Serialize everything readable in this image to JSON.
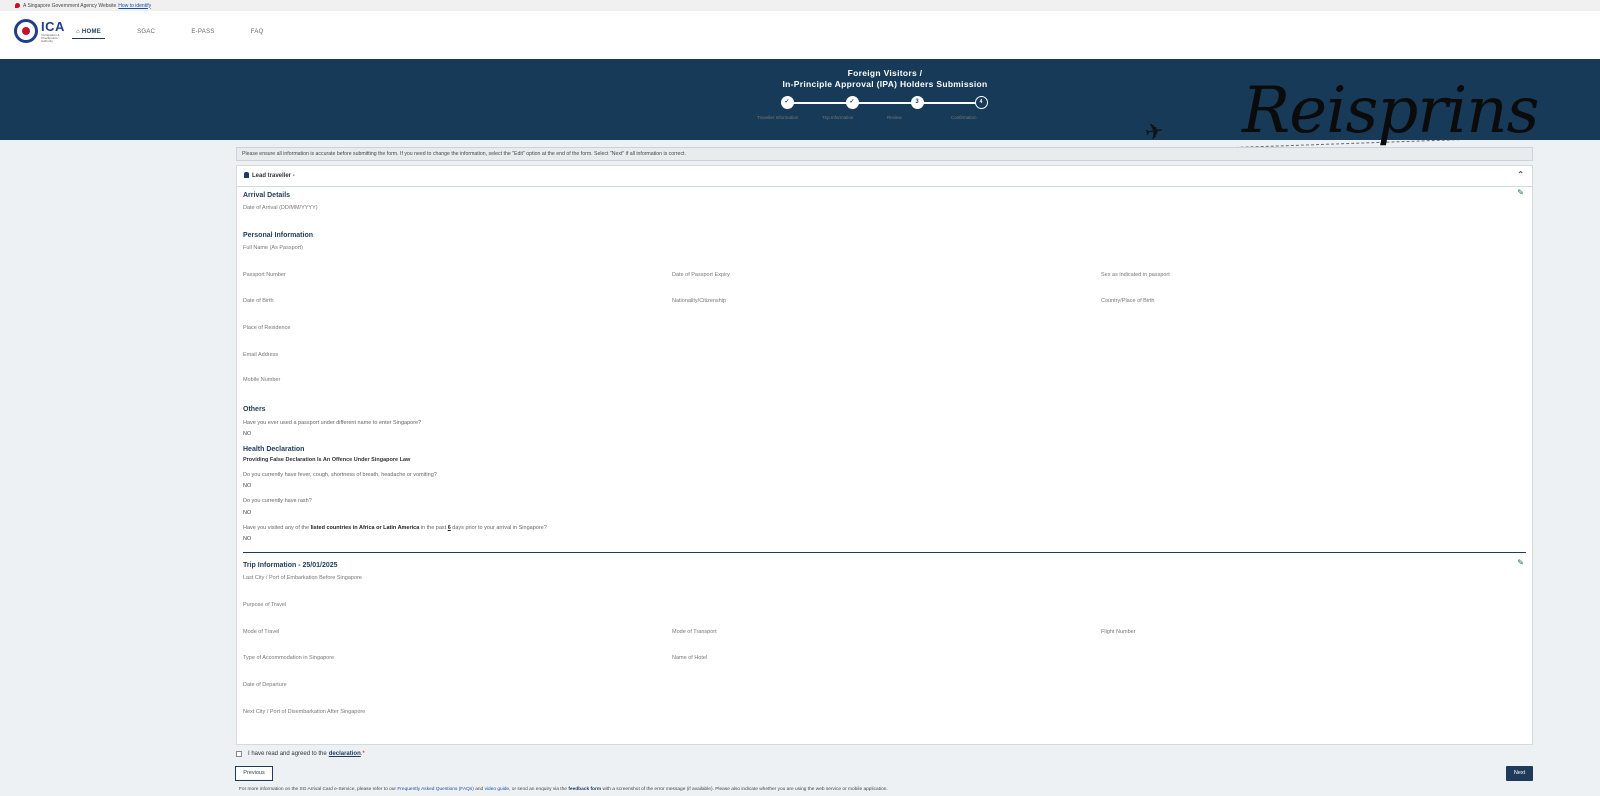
{
  "gov_bar": {
    "text": "A Singapore Government Agency Website",
    "link": "How to identify"
  },
  "logo": {
    "name": "ICA",
    "tagline": "Immigration & Checkpoints Authority"
  },
  "nav": {
    "home": "HOME",
    "sgac": "SGAC",
    "epass": "E-PASS",
    "faq": "FAQ"
  },
  "banner": {
    "title_line1": "Foreign Visitors /",
    "title_line2": "In-Principle Approval (IPA) Holders Submission",
    "brand": "Reisprins"
  },
  "steps": [
    {
      "label": "Traveller Information",
      "marker": "✓"
    },
    {
      "label": "Trip Information",
      "marker": "✓"
    },
    {
      "label": "Review",
      "marker": "3"
    },
    {
      "label": "Confirmation",
      "marker": "4"
    }
  ],
  "notice": "Please ensure all information is accurate before submitting the form. If you need to change the information, select the \"Edit\" option at the end of the form. Select \"Next\" if all information is correct.",
  "card": {
    "header": "Lead traveller -",
    "arrival": {
      "title": "Arrival Details",
      "date_label": "Date of Arrival (DD/MM/YYYY)"
    },
    "personal": {
      "title": "Personal Information",
      "full_name": "Full Name (As Passport)",
      "passport_number": "Passport Number",
      "passport_expiry": "Date of Passport Expiry",
      "sex": "Sex as indicated in passport",
      "dob": "Date of Birth",
      "nationality": "Nationality/Citizenship",
      "country_birth": "Country/Place of Birth",
      "residence": "Place of Residence",
      "email": "Email Address",
      "mobile": "Mobile Number"
    },
    "others": {
      "title": "Others",
      "q1": "Have you ever used a passport under different name to enter Singapore?",
      "a1": "NO"
    },
    "health": {
      "title": "Health Declaration",
      "subtitle": "Providing False Declaration Is An Offence Under Singapore Law",
      "q1": "Do you currently have fever, cough, shortness of breath, headache or vomiting?",
      "a1": "NO",
      "q2": "Do you currently have rash?",
      "a2": "NO",
      "q3_pre": "Have you visited any of the ",
      "q3_bold": "listed countries in Africa or Latin America",
      "q3_mid": " in the past ",
      "q3_days": "6",
      "q3_post": " days prior to your arrival in Singapore?",
      "a3": "NO"
    },
    "trip": {
      "title": "Trip Information - 25/01/2025",
      "last_city": "Last City / Port of Embarkation Before Singapore",
      "purpose": "Purpose of Travel",
      "mode_travel": "Mode of Travel",
      "mode_transport": "Mode of Transport",
      "flight": "Flight Number",
      "accommodation": "Type of Accommodation in Singapore",
      "hotel": "Name of Hotel",
      "departure": "Date of Departure",
      "next_city": "Next City / Port of Disembarkation After Singapore"
    }
  },
  "footer": {
    "agree_text": "I have read and agreed to the",
    "agree_link": "declaration",
    "agree_star": ".*",
    "previous": "Previous",
    "next": "Next",
    "info_pre": "For more information on the SG Arrival Card e-Service, please refer to our ",
    "info_faq": "Frequently Asked Questions (FAQs)",
    "info_and": " and ",
    "info_video": "video guide",
    "info_mid": ", or send an enquiry via the ",
    "info_feedback": "feedback form",
    "info_post": " with a screenshot of the error message (if available). Please also indicate whether you are using the web service or mobile application."
  },
  "colors": {
    "primary": "#183a59",
    "edit": "#1e6b3a"
  }
}
